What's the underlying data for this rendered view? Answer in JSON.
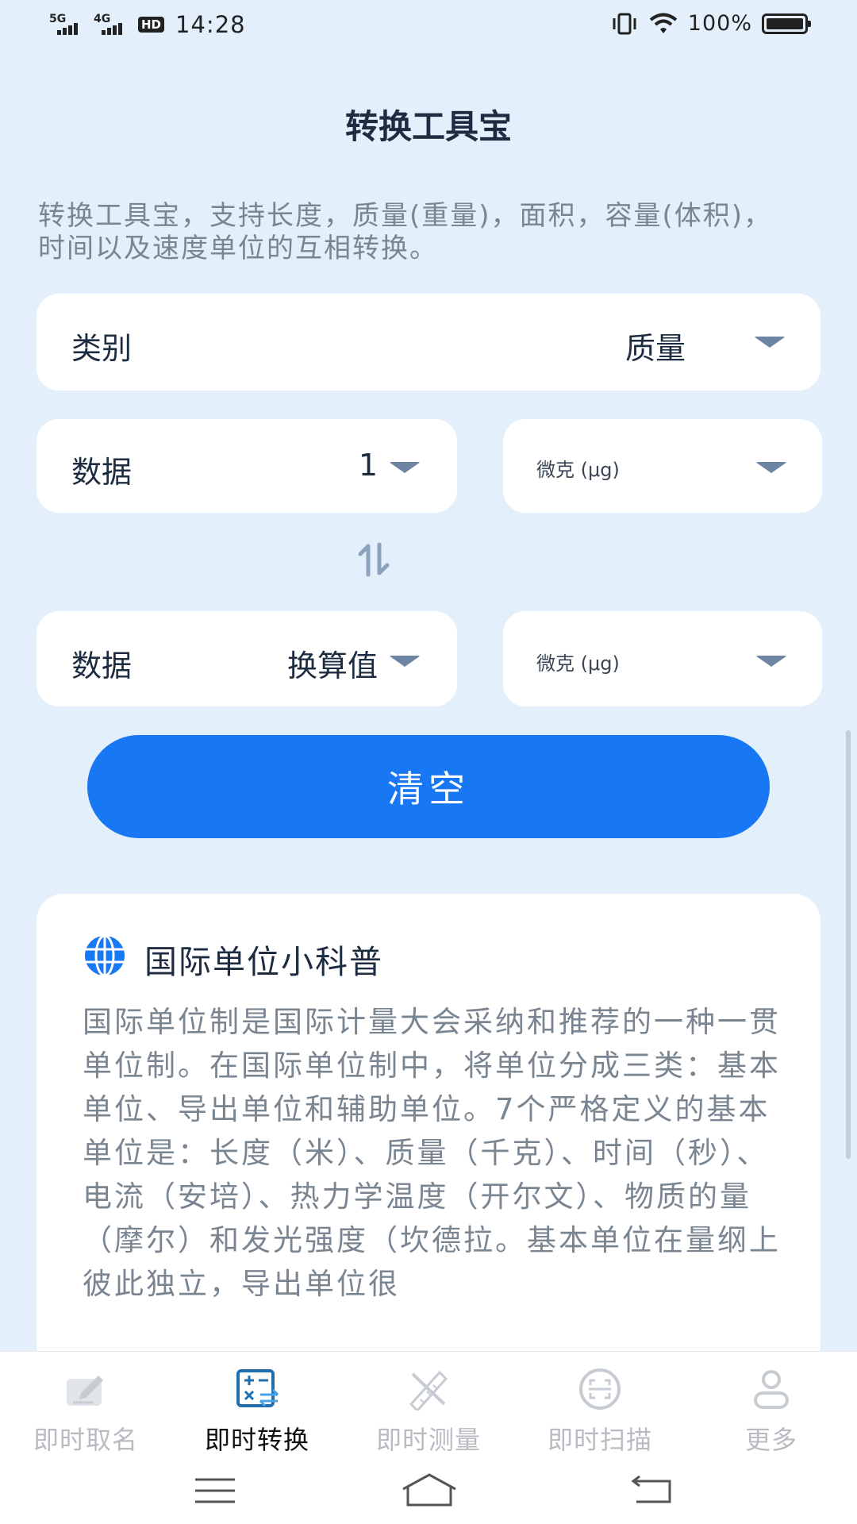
{
  "status_bar": {
    "signal1_label": "5G",
    "signal2_label": "4G",
    "hd_label": "HD",
    "time": "14:28",
    "battery_percent": "100%"
  },
  "app": {
    "title": "转换工具宝",
    "description": "转换工具宝，支持长度，质量(重量)，面积，容量(体积)，时间以及速度单位的互相转换。"
  },
  "converter": {
    "category": {
      "label": "类别",
      "value": "质量"
    },
    "input": {
      "label": "数据",
      "value": "1",
      "unit": "微克 (μg)"
    },
    "output": {
      "label": "数据",
      "value": "换算值",
      "unit": "微克 (μg)"
    },
    "clear_label": "清空"
  },
  "info": {
    "title": "国际单位小科普",
    "body": "国际单位制是国际计量大会采纳和推荐的一种一贯单位制。在国际单位制中，将单位分成三类：基本单位、导出单位和辅助单位。7个严格定义的基本单位是：长度（米）、质量（千克）、时间（秒）、电流（安培）、热力学温度（开尔文）、物质的量（摩尔）和发光强度（坎德拉。基本单位在量纲上彼此独立，导出单位很"
  },
  "nav": {
    "items": [
      {
        "label": "即时取名",
        "icon": "pencil-icon",
        "active": false
      },
      {
        "label": "即时转换",
        "icon": "calculator-icon",
        "active": true
      },
      {
        "label": "即时测量",
        "icon": "ruler-icon",
        "active": false
      },
      {
        "label": "即时扫描",
        "icon": "scan-icon",
        "active": false
      },
      {
        "label": "更多",
        "icon": "person-icon",
        "active": false
      }
    ]
  },
  "colors": {
    "background": "#e3effb",
    "accent": "#1877f2",
    "caret": "#6e84a3",
    "muted_text": "#7a8592"
  }
}
